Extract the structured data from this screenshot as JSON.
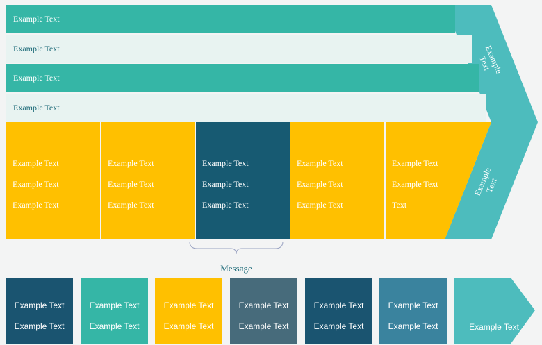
{
  "rows": [
    {
      "label": "Example Text"
    },
    {
      "label": "Example Text"
    },
    {
      "label": "Example Text"
    },
    {
      "label": "Example Text"
    }
  ],
  "columns": [
    {
      "lines": [
        "Example Text",
        "Example Text",
        "Example Text"
      ],
      "color": "#ffc000"
    },
    {
      "lines": [
        "Example Text",
        "Example Text",
        "Example Text"
      ],
      "color": "#ffc000"
    },
    {
      "lines": [
        "Example Text",
        "Example Text",
        "Example Text"
      ],
      "color": "#175a72"
    },
    {
      "lines": [
        "Example Text",
        "Example Text",
        "Example Text"
      ],
      "color": "#ffc000"
    },
    {
      "lines": [
        "Example Text",
        "Example Text",
        "Text"
      ],
      "color": "#ffc000"
    }
  ],
  "arrow": {
    "upper_text": [
      "Example",
      "Text"
    ],
    "lower_text": [
      "Example",
      "Text"
    ],
    "color": "#4dbcbd"
  },
  "message": "Message",
  "boxes": [
    {
      "lines": [
        "Example Text",
        "Example Text"
      ],
      "color": "#1a5470"
    },
    {
      "lines": [
        "Example Text",
        "Example Text"
      ],
      "color": "#35b6a6"
    },
    {
      "lines": [
        "Example Text",
        "Example Text"
      ],
      "color": "#ffc000"
    },
    {
      "lines": [
        "Example Text",
        "Example Text"
      ],
      "color": "#476b7b"
    },
    {
      "lines": [
        "Example Text",
        "Example Text"
      ],
      "color": "#1a5470"
    },
    {
      "lines": [
        "Example Text",
        "Example Text"
      ],
      "color": "#3a839e"
    }
  ],
  "final_arrow": {
    "label": "Example Text",
    "color": "#4dbcbd"
  }
}
